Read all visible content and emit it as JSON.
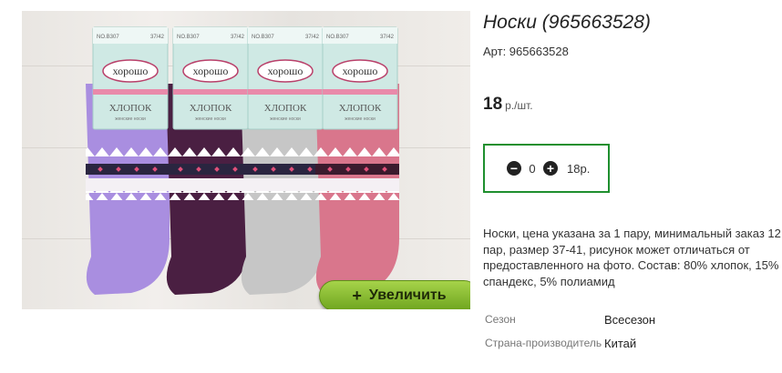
{
  "product": {
    "title": "Носки (965663528)",
    "article": "Арт: 965663528",
    "price_value": "18",
    "price_unit": "р./шт.",
    "description": "Носки, цена указана за 1 пару, минимальный заказ 12 пар, размер 37-41, рисунок может отличаться от предоставленного на фото. Состав: 80% хлопок, 15% спандекс, 5% полиамид"
  },
  "image": {
    "zoom_label": "Увеличить",
    "zoom_plus": "+",
    "package_brand": "хорошо",
    "package_text": "ХЛОПОК",
    "package_sub": "женские носки",
    "package_code": "NO.B307",
    "package_size": "37/42",
    "sock_colors": [
      "#a98ee0",
      "#4a1f42",
      "#c6c6c6",
      "#d9768c"
    ]
  },
  "cart": {
    "minus": "−",
    "plus": "+",
    "quantity": "0",
    "sum": "18р."
  },
  "properties": [
    {
      "key": "Сезон",
      "value": "Всесезон"
    },
    {
      "key": "Страна-производитель",
      "value": "Китай"
    }
  ]
}
